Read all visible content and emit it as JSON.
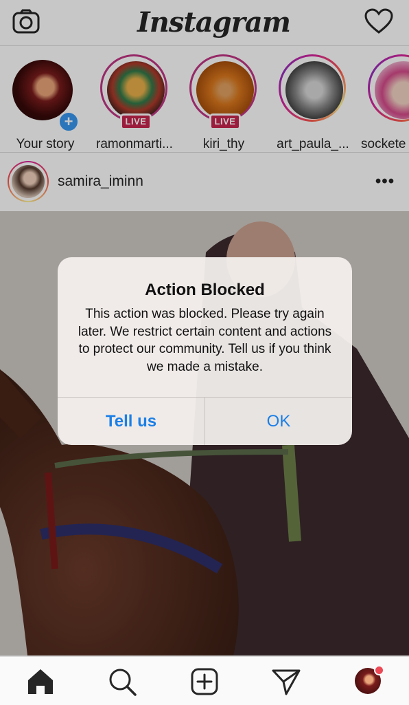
{
  "header": {
    "logo": "Instagram",
    "camera_icon": "camera-icon",
    "activity_icon": "heart-icon"
  },
  "stories": [
    {
      "name": "Your story",
      "own": true,
      "live": false
    },
    {
      "name": "ramonmarti...",
      "own": false,
      "live": true
    },
    {
      "name": "kiri_thy",
      "own": false,
      "live": true
    },
    {
      "name": "art_paula_...",
      "own": false,
      "live": false
    },
    {
      "name": "sockete",
      "own": false,
      "live": false
    }
  ],
  "live_label": "LIVE",
  "post": {
    "username": "samira_iminn",
    "more": "•••"
  },
  "alert": {
    "title": "Action Blocked",
    "message": "This action was blocked. Please try again later. We restrict certain content and actions to protect our community. Tell us if you think we made a mistake.",
    "button_tell_us": "Tell us",
    "button_ok": "OK"
  },
  "tabbar": {
    "items": [
      "home-icon",
      "search-icon",
      "new-post-icon",
      "direct-icon",
      "profile-avatar"
    ]
  },
  "colors": {
    "accent": "#1b7fe6",
    "live": "#c7254e",
    "notification": "#ed4956"
  }
}
